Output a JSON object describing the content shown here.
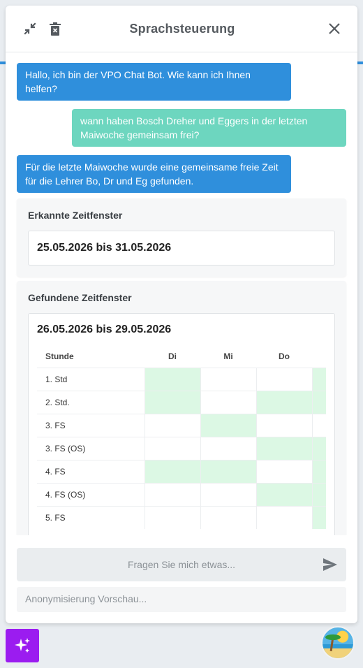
{
  "header": {
    "title": "Sprachsteuerung",
    "icons": [
      "minimize-icon",
      "delete-icon",
      "close-icon"
    ]
  },
  "messages": [
    {
      "role": "bot",
      "text": "Hallo, ich bin der VPO Chat Bot. Wie kann ich Ihnen helfen?"
    },
    {
      "role": "user",
      "text": "wann haben Bosch Dreher und Eggers in der letzten Maiwoche gemeinsam frei?"
    },
    {
      "role": "bot",
      "text": "Für die letzte Maiwoche wurde eine gemeinsame freie Zeit für die Lehrer Bo, Dr und Eg gefunden."
    }
  ],
  "recognized": {
    "heading": "Erkannte Zeitfenster",
    "range": "25.05.2026 bis 31.05.2026"
  },
  "found": {
    "heading": "Gefundene Zeitfenster",
    "range": "26.05.2026 bis 29.05.2026",
    "columns": [
      "Stunde",
      "Di",
      "Mi",
      "Do",
      ""
    ],
    "rows": [
      {
        "label": "1. Std",
        "free": [
          true,
          false,
          false,
          true
        ]
      },
      {
        "label": "2. Std.",
        "free": [
          true,
          false,
          true,
          true
        ]
      },
      {
        "label": "3. FS",
        "free": [
          false,
          true,
          false,
          false
        ]
      },
      {
        "label": "3. FS (OS)",
        "free": [
          false,
          false,
          true,
          true
        ]
      },
      {
        "label": "4. FS",
        "free": [
          true,
          true,
          false,
          true
        ]
      },
      {
        "label": "4. FS (OS)",
        "free": [
          false,
          false,
          true,
          true
        ]
      },
      {
        "label": "5. FS",
        "free": [
          false,
          false,
          false,
          true
        ]
      }
    ]
  },
  "composer": {
    "placeholder": "Fragen Sie mich etwas...",
    "anonymization_placeholder": "Anonymisierung Vorschau..."
  },
  "colors": {
    "bot_bubble": "#2f8fdc",
    "user_bubble": "#6dd6bf",
    "free_slot": "#dcf8e4",
    "ai_button": "#9b1cf0"
  }
}
